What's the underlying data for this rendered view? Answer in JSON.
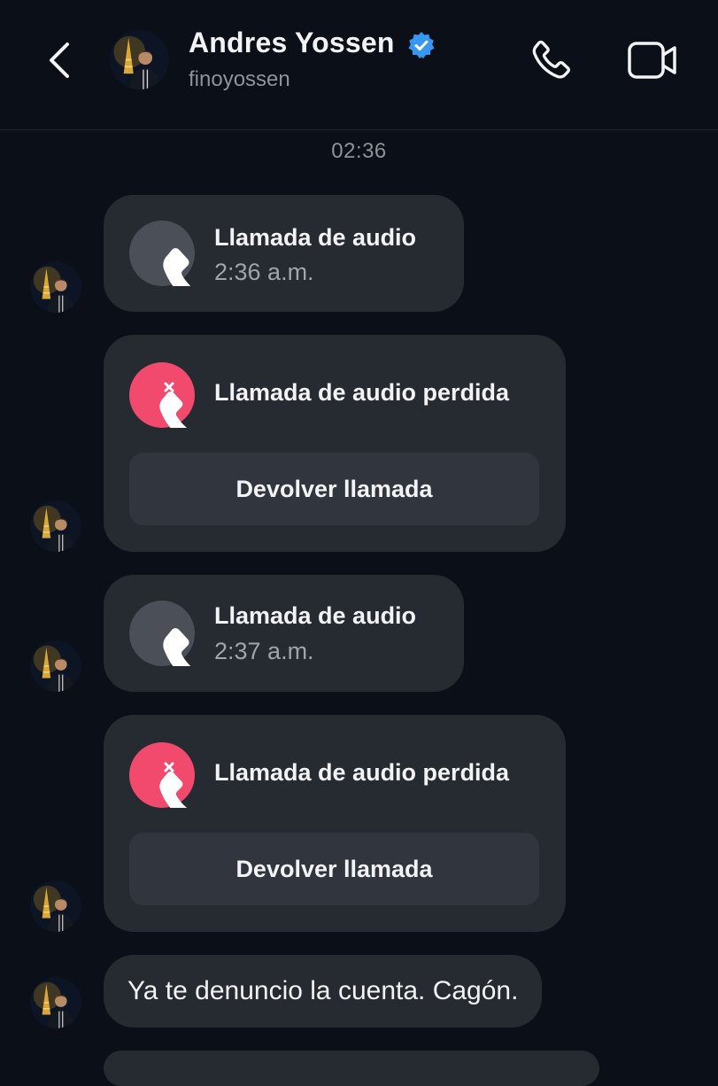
{
  "header": {
    "contact_name": "Andres Yossen",
    "username": "finoyossen"
  },
  "timestamp": "02:36",
  "messages": [
    {
      "type": "call",
      "missed": false,
      "title": "Llamada de audio",
      "time": "2:36 a.m."
    },
    {
      "type": "call",
      "missed": true,
      "title": "Llamada de audio perdida",
      "action": "Devolver llamada"
    },
    {
      "type": "call",
      "missed": false,
      "title": "Llamada de audio",
      "time": "2:37 a.m."
    },
    {
      "type": "call",
      "missed": true,
      "title": "Llamada de audio perdida",
      "action": "Devolver llamada"
    },
    {
      "type": "text",
      "text": "Ya te denuncio la cuenta. Cagón."
    }
  ],
  "icons": {
    "back": "chevron-left-icon",
    "verified": "verified-badge-icon",
    "call": "phone-icon",
    "video": "video-camera-icon",
    "missed": "missed-call-icon"
  },
  "colors": {
    "background": "#0b0f17",
    "bubble": "#262a31",
    "button": "#31353d",
    "missed_accent": "#f24a6c",
    "verified": "#3897f0"
  }
}
